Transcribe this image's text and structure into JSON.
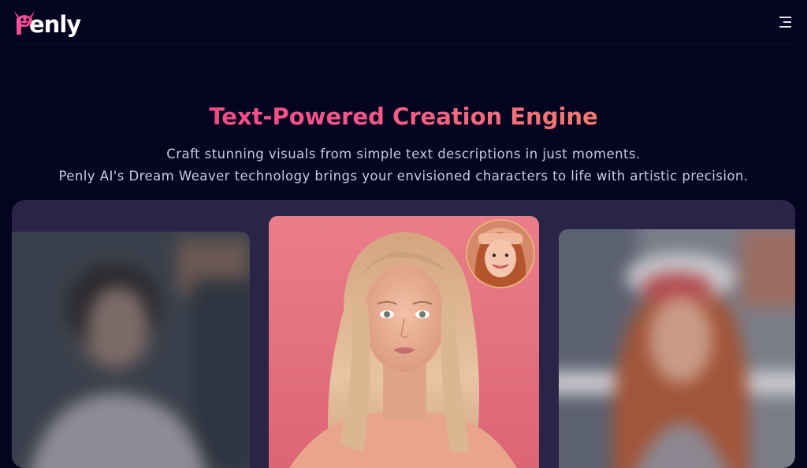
{
  "brand": {
    "name": "Penly",
    "logo_text": "enly",
    "accent_pink": "#ee3b83",
    "accent_orange": "#f79a55",
    "background": "#050420",
    "panel": "#2a2447"
  },
  "header": {
    "menu_icon": "hamburger-menu-icon"
  },
  "hero": {
    "title": "Text-Powered Creation Engine",
    "line1": "Craft stunning visuals from simple text descriptions in just moments.",
    "line2": "Penly AI's Dream Weaver technology brings your envisioned characters to life with artistic precision."
  },
  "showcase": {
    "images": [
      {
        "description_icon": "blurred-portrait-image"
      },
      {
        "description_icon": "featured-portrait-image"
      },
      {
        "description_icon": "blurred-portrait-image"
      }
    ],
    "badge_icon": "reference-face-avatar"
  }
}
